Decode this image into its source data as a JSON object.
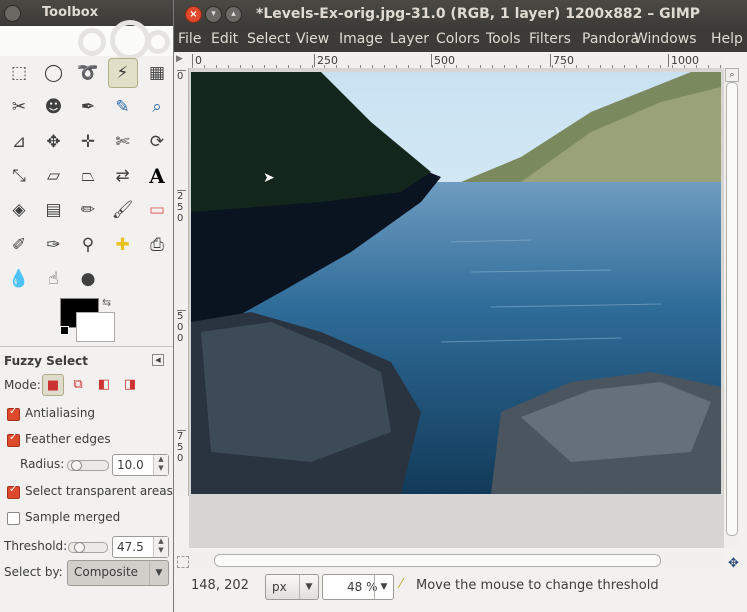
{
  "toolbox": {
    "title": "Toolbox",
    "options_title": "Fuzzy Select",
    "mode_label": "Mode:",
    "antialiasing_label": "Antialiasing",
    "antialiasing": true,
    "feather_label": "Feather edges",
    "feather": true,
    "radius_label": "Radius:",
    "radius_value": "10.0",
    "radius_level": 0.1,
    "transparent_label": "Select transparent areas",
    "transparent": true,
    "sample_merged_label": "Sample merged",
    "sample_merged": false,
    "threshold_label": "Threshold:",
    "threshold_value": "47.5",
    "threshold_level": 0.19,
    "select_by_label": "Select by:",
    "select_by_value": "Composite",
    "tools": [
      [
        "rect-select-icon",
        "ellipse-select-icon",
        "free-select-icon",
        "fuzzy-select-icon",
        "by-color-select-icon"
      ],
      [
        "scissors-select-icon",
        "foreground-select-icon",
        "paths-icon",
        "color-picker-icon",
        "zoom-icon"
      ],
      [
        "measure-icon",
        "move-icon",
        "align-icon",
        "crop-icon",
        "rotate-icon"
      ],
      [
        "scale-icon",
        "shear-icon",
        "perspective-icon",
        "flip-icon",
        "text-icon"
      ],
      [
        "bucket-fill-icon",
        "blend-icon",
        "pencil-icon",
        "paintbrush-icon",
        "eraser-icon"
      ],
      [
        "airbrush-icon",
        "ink-icon",
        "clone-icon",
        "heal-icon",
        "perspective-clone-icon"
      ],
      [
        "blur-icon",
        "smudge-icon",
        "dodge-burn-icon"
      ]
    ],
    "active_tool": "fuzzy-select-icon",
    "fg_color": "#000000",
    "bg_color": "#ffffff"
  },
  "image_window": {
    "title": "*Levels-Ex-orig.jpg-31.0 (RGB, 1 layer) 1200x882 – GIMP",
    "menu": [
      "File",
      "Edit",
      "Select",
      "View",
      "Image",
      "Layer",
      "Colors",
      "Tools",
      "Filters",
      "Pandora",
      "Windows",
      "Help"
    ],
    "hruler_ticks": [
      "0",
      "250",
      "500",
      "750",
      "1000"
    ],
    "vruler_ticks": [
      "0",
      "250",
      "500",
      "750"
    ],
    "status": {
      "coords": "148, 202",
      "unit": "px",
      "zoom": "48 %",
      "message": "Move the mouse to change threshold"
    }
  },
  "colors": {
    "titlebar": "#3c3b37",
    "close_button": "#df4a2c",
    "accent": "#df4a2c"
  }
}
